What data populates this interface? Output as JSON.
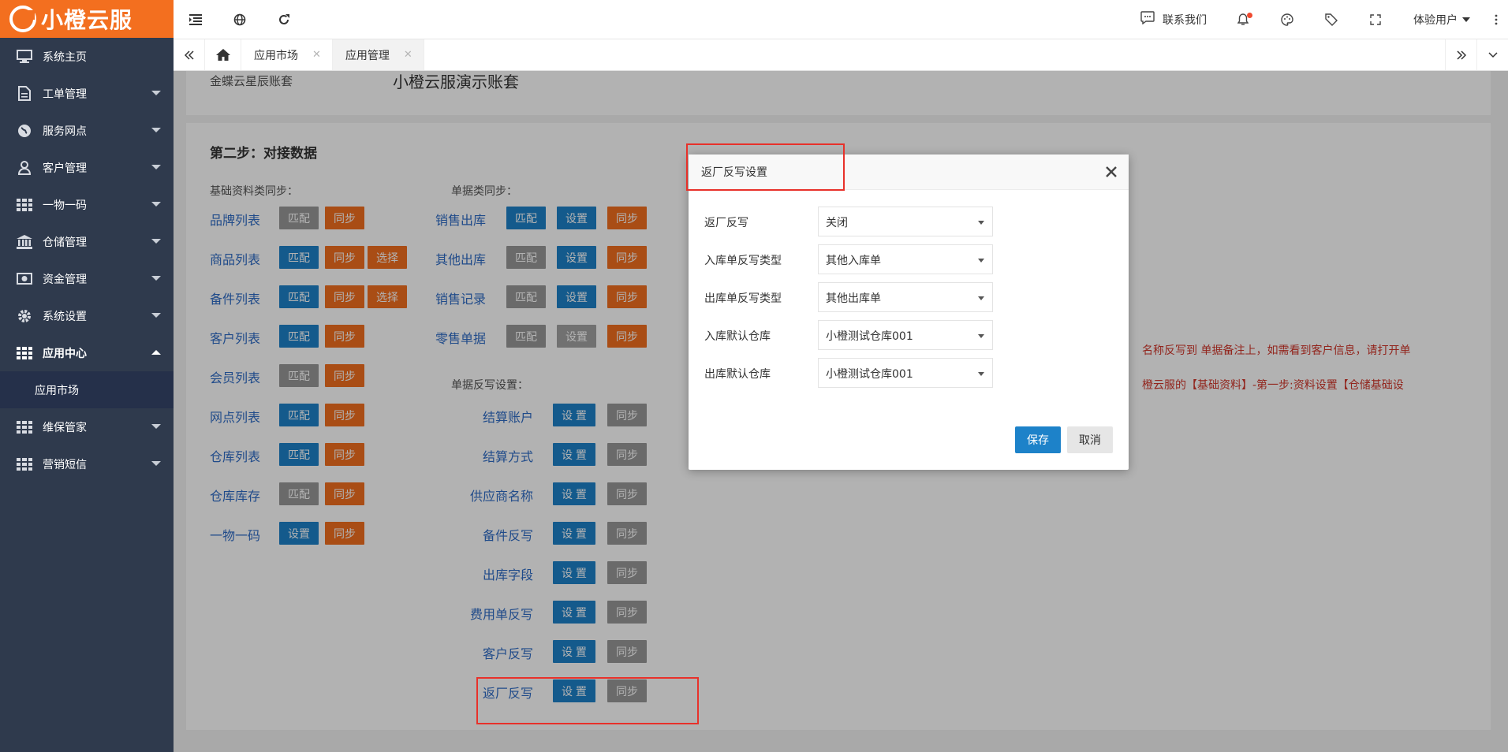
{
  "brand": {
    "logo_text": "小橙云服"
  },
  "sidebar": {
    "items": [
      {
        "label": "系统主页",
        "icon": "monitor-icon"
      },
      {
        "label": "工单管理",
        "icon": "document-icon"
      },
      {
        "label": "服务网点",
        "icon": "globe-icon"
      },
      {
        "label": "客户管理",
        "icon": "user-icon"
      },
      {
        "label": "一物一码",
        "icon": "grid-icon"
      },
      {
        "label": "仓储管理",
        "icon": "bank-icon"
      },
      {
        "label": "资金管理",
        "icon": "money-icon"
      },
      {
        "label": "系统设置",
        "icon": "gear-icon"
      },
      {
        "label": "应用中心",
        "icon": "grid-icon"
      },
      {
        "label": "维保管家",
        "icon": "grid-icon"
      },
      {
        "label": "营销短信",
        "icon": "grid-icon"
      }
    ],
    "sub_item": "应用市场"
  },
  "topbar": {
    "contact": "联系我们",
    "user": "体验用户"
  },
  "tabs": [
    {
      "label": "应用市场"
    },
    {
      "label": "应用管理"
    }
  ],
  "content": {
    "account_key": "金蝶云星辰账套",
    "account_value": "小橙云服演示账套",
    "step_title": "第二步：对接数据",
    "basic_label": "基础资料类同步：",
    "doc_label": "单据类同步：",
    "writeback_label": "单据反写设置：",
    "basic_rows": [
      {
        "name": "品牌列表",
        "b1": "匹配",
        "b2": "同步",
        "b3": ""
      },
      {
        "name": "商品列表",
        "b1": "匹配",
        "b2": "同步",
        "b3": "选择"
      },
      {
        "name": "备件列表",
        "b1": "匹配",
        "b2": "同步",
        "b3": "选择"
      },
      {
        "name": "客户列表",
        "b1": "匹配",
        "b2": "同步",
        "b3": ""
      },
      {
        "name": "会员列表",
        "b1": "匹配",
        "b2": "同步",
        "b3": ""
      },
      {
        "name": "网点列表",
        "b1": "匹配",
        "b2": "同步",
        "b3": ""
      },
      {
        "name": "仓库列表",
        "b1": "匹配",
        "b2": "同步",
        "b3": ""
      },
      {
        "name": "仓库库存",
        "b1": "匹配",
        "b2": "同步",
        "b3": ""
      },
      {
        "name": "一物一码",
        "b1": "设置",
        "b2": "同步",
        "b3": ""
      }
    ],
    "doc_rows": [
      {
        "name": "销售出库",
        "b1": "匹配",
        "b2": "设置",
        "b3": "同步"
      },
      {
        "name": "其他出库",
        "b1": "匹配",
        "b2": "设置",
        "b3": "同步"
      },
      {
        "name": "销售记录",
        "b1": "匹配",
        "b2": "设置",
        "b3": "同步"
      },
      {
        "name": "零售单据",
        "b1": "匹配",
        "b2": "设置",
        "b3": "同步"
      }
    ],
    "writeback_rows": [
      {
        "name": "结算账户",
        "b1": "设 置",
        "b2": "同步"
      },
      {
        "name": "结算方式",
        "b1": "设 置",
        "b2": "同步"
      },
      {
        "name": "供应商名称",
        "b1": "设 置",
        "b2": "同步"
      },
      {
        "name": "备件反写",
        "b1": "设 置",
        "b2": "同步"
      },
      {
        "name": "出库字段",
        "b1": "设 置",
        "b2": "同步"
      },
      {
        "name": "费用单反写",
        "b1": "设 置",
        "b2": "同步"
      },
      {
        "name": "客户反写",
        "b1": "设 置",
        "b2": "同步"
      },
      {
        "name": "返厂反写",
        "b1": "设 置",
        "b2": "同步"
      }
    ],
    "note1": "名称反写到 单据备注上，如需看到客户信息，请打开单",
    "note2": "橙云服的【基础资料】-第一步:资料设置【仓储基础设"
  },
  "modal": {
    "title": "返厂反写设置",
    "fields": [
      {
        "label": "返厂反写",
        "value": "关闭"
      },
      {
        "label": "入库单反写类型",
        "value": "其他入库单"
      },
      {
        "label": "出库单反写类型",
        "value": "其他出库单"
      },
      {
        "label": "入库默认仓库",
        "value": "小橙测试仓库001"
      },
      {
        "label": "出库默认仓库",
        "value": "小橙测试仓库001"
      }
    ],
    "save": "保存",
    "cancel": "取消"
  }
}
